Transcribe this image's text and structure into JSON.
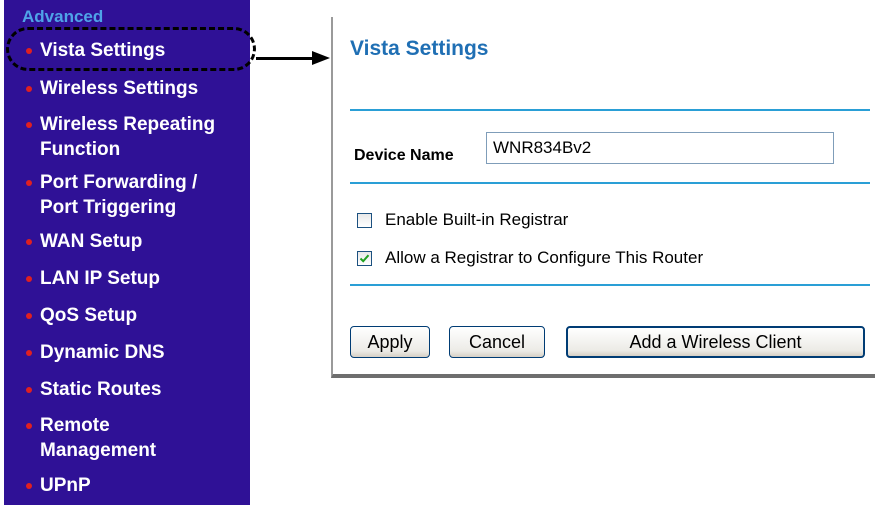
{
  "sidebar": {
    "heading": "Advanced",
    "items": [
      {
        "lines": [
          "Vista Settings"
        ]
      },
      {
        "lines": [
          "Wireless Settings"
        ]
      },
      {
        "lines": [
          "Wireless Repeating",
          "Function"
        ]
      },
      {
        "lines": [
          "Port Forwarding /",
          "Port Triggering"
        ]
      },
      {
        "lines": [
          "WAN Setup"
        ]
      },
      {
        "lines": [
          "LAN IP Setup"
        ]
      },
      {
        "lines": [
          "QoS Setup"
        ]
      },
      {
        "lines": [
          "Dynamic DNS"
        ]
      },
      {
        "lines": [
          "Static Routes"
        ]
      },
      {
        "lines": [
          "Remote",
          "Management"
        ]
      },
      {
        "lines": [
          "UPnP"
        ]
      }
    ]
  },
  "panel": {
    "title": "Vista Settings",
    "device_name_label": "Device Name",
    "device_name_value": "WNR834Bv2",
    "options": [
      {
        "label": "Enable Built-in Registrar",
        "checked": false
      },
      {
        "label": "Allow a Registrar to Configure This Router",
        "checked": true
      }
    ],
    "buttons": {
      "apply": "Apply",
      "cancel": "Cancel",
      "add_client": "Add a Wireless Client"
    }
  },
  "colors": {
    "sidebar_bg": "#2f1196",
    "heading": "#4fa3e8",
    "title": "#1f6fb4",
    "divider": "#2a9fd6",
    "bullet": "#e02020"
  }
}
